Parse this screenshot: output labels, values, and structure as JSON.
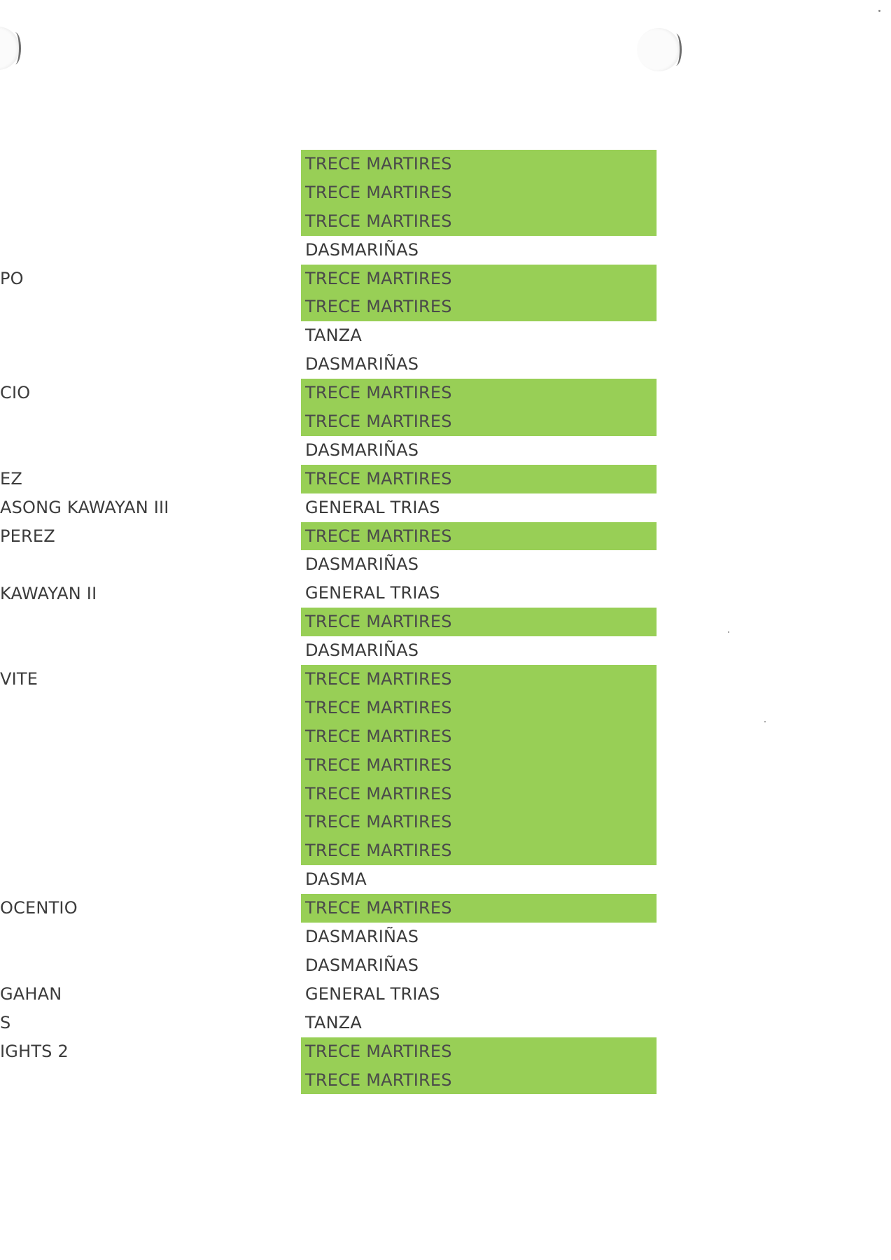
{
  "left_column": [
    {
      "row": 4,
      "text": "PO"
    },
    {
      "row": 8,
      "text": "CIO"
    },
    {
      "row": 11,
      "text": "EZ"
    },
    {
      "row": 12,
      "text": "ASONG KAWAYAN III"
    },
    {
      "row": 13,
      "text": "PEREZ"
    },
    {
      "row": 15,
      "text": " KAWAYAN II"
    },
    {
      "row": 18,
      "text": "VITE"
    },
    {
      "row": 26,
      "text": "OCENTIO"
    },
    {
      "row": 29,
      "text": "GAHAN"
    },
    {
      "row": 30,
      "text": "S"
    },
    {
      "row": 31,
      "text": "IGHTS 2"
    }
  ],
  "city_column": [
    {
      "text": "TRECE MARTIRES",
      "highlight": true
    },
    {
      "text": "TRECE MARTIRES",
      "highlight": true
    },
    {
      "text": "TRECE MARTIRES",
      "highlight": true
    },
    {
      "text": "DASMARIÑAS",
      "highlight": false
    },
    {
      "text": "TRECE MARTIRES",
      "highlight": true
    },
    {
      "text": "TRECE MARTIRES",
      "highlight": true
    },
    {
      "text": "TANZA",
      "highlight": false
    },
    {
      "text": "DASMARIÑAS",
      "highlight": false
    },
    {
      "text": "TRECE MARTIRES",
      "highlight": true
    },
    {
      "text": "TRECE MARTIRES",
      "highlight": true
    },
    {
      "text": "DASMARIÑAS",
      "highlight": false
    },
    {
      "text": "TRECE MARTIRES",
      "highlight": true
    },
    {
      "text": "GENERAL TRIAS",
      "highlight": false
    },
    {
      "text": "TRECE MARTIRES",
      "highlight": true
    },
    {
      "text": "DASMARIÑAS",
      "highlight": false
    },
    {
      "text": "GENERAL TRIAS",
      "highlight": false
    },
    {
      "text": "TRECE MARTIRES",
      "highlight": true
    },
    {
      "text": "DASMARIÑAS",
      "highlight": false
    },
    {
      "text": "TRECE MARTIRES",
      "highlight": true
    },
    {
      "text": "TRECE MARTIRES",
      "highlight": true
    },
    {
      "text": "TRECE MARTIRES",
      "highlight": true
    },
    {
      "text": "TRECE MARTIRES",
      "highlight": true
    },
    {
      "text": "TRECE MARTIRES",
      "highlight": true
    },
    {
      "text": "TRECE MARTIRES",
      "highlight": true
    },
    {
      "text": "TRECE MARTIRES",
      "highlight": true
    },
    {
      "text": "DASMA",
      "highlight": false
    },
    {
      "text": "TRECE MARTIRES",
      "highlight": true
    },
    {
      "text": "DASMARIÑAS",
      "highlight": false
    },
    {
      "text": "DASMARIÑAS",
      "highlight": false
    },
    {
      "text": "GENERAL TRIAS",
      "highlight": false
    },
    {
      "text": "TANZA",
      "highlight": false
    },
    {
      "text": "TRECE MARTIRES",
      "highlight": true
    },
    {
      "text": "TRECE MARTIRES",
      "highlight": true
    }
  ],
  "colors": {
    "highlight": "#98cf56",
    "text": "#3a3a3a",
    "paper": "#ffffff"
  }
}
